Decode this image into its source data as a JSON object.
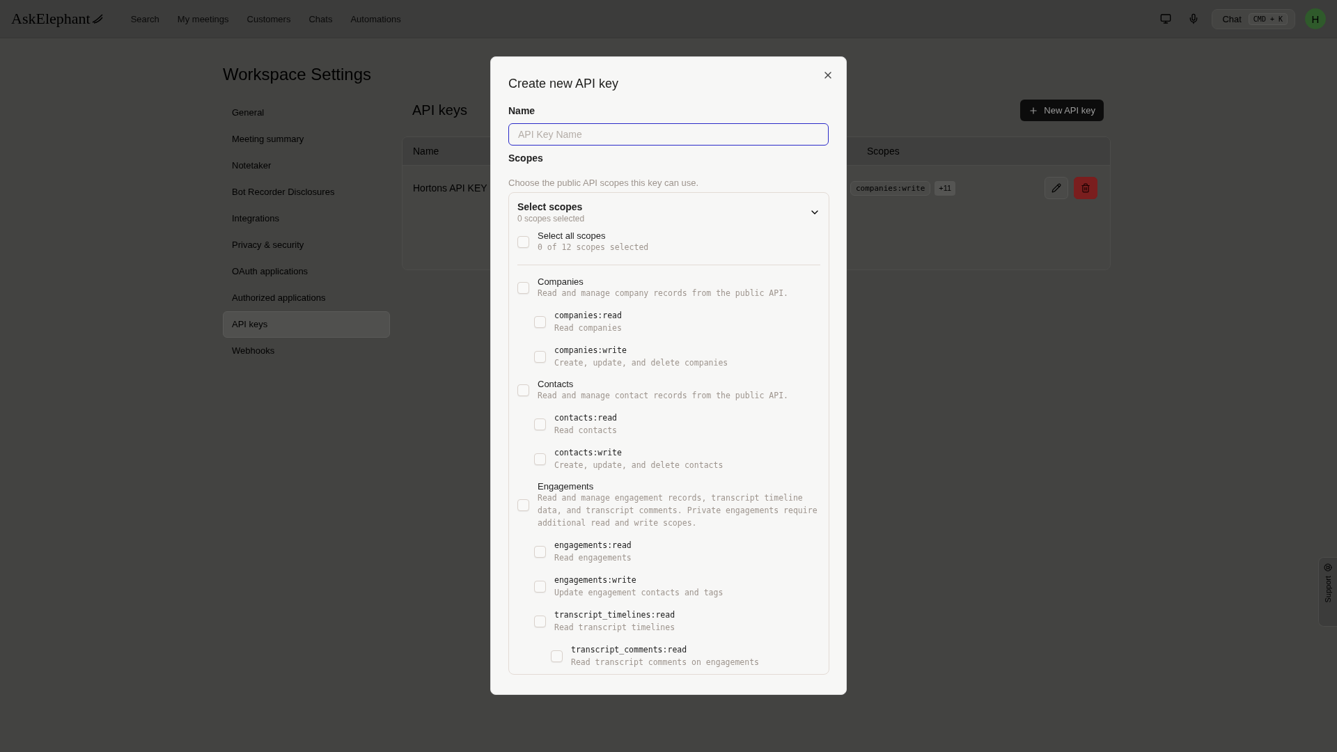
{
  "top_bar": {
    "logo": "AskElephant",
    "nav": [
      "Search",
      "My meetings",
      "Customers",
      "Chats",
      "Automations"
    ],
    "chat_button": "Chat",
    "shortcut": "CMD + K",
    "avatar": "H"
  },
  "page_title": "Workspace Settings",
  "sidebar": {
    "items": [
      {
        "label": "General",
        "selected": false
      },
      {
        "label": "Meeting summary",
        "selected": false
      },
      {
        "label": "Notetaker",
        "selected": false
      },
      {
        "label": "Bot Recorder Disclosures",
        "selected": false
      },
      {
        "label": "Integrations",
        "selected": false
      },
      {
        "label": "Privacy & security",
        "selected": false
      },
      {
        "label": "OAuth applications",
        "selected": false
      },
      {
        "label": "Authorized applications",
        "selected": false
      },
      {
        "label": "API keys",
        "selected": true
      },
      {
        "label": "Webhooks",
        "selected": false
      }
    ]
  },
  "content": {
    "title": "API keys",
    "new_button": "New API key",
    "table": {
      "columns": [
        "Name",
        "Scopes"
      ],
      "rows": [
        {
          "name": "Hortons API KEY",
          "scopes": [
            "companies:write"
          ],
          "more": "+11"
        }
      ]
    }
  },
  "support_tab": "Support",
  "dialog": {
    "title": "Create new API key",
    "name_label": "Name",
    "name_placeholder": "API Key Name",
    "scopes_label": "Scopes",
    "scopes_hint": "Choose the public API scopes this key can use.",
    "selector": {
      "title": "Select scopes",
      "summary": "0 scopes selected",
      "expanded": true,
      "select_all": {
        "label": "Select all scopes",
        "summary": "0 of 12 scopes selected",
        "checked": false
      },
      "groups": [
        {
          "name": "Companies",
          "description": "Read and manage company records from the public API.",
          "checked": false,
          "children": [
            {
              "name": "companies:read",
              "description": "Read companies",
              "checked": false
            },
            {
              "name": "companies:write",
              "description": "Create, update, and delete companies",
              "checked": false
            }
          ]
        },
        {
          "name": "Contacts",
          "description": "Read and manage contact records from the public API.",
          "checked": false,
          "children": [
            {
              "name": "contacts:read",
              "description": "Read contacts",
              "checked": false
            },
            {
              "name": "contacts:write",
              "description": "Create, update, and delete contacts",
              "checked": false
            }
          ]
        },
        {
          "name": "Engagements",
          "description": "Read and manage engagement records, transcript timeline data, and transcript comments. Private engagements require additional read and write scopes.",
          "checked": false,
          "children": [
            {
              "name": "engagements:read",
              "description": "Read engagements",
              "checked": false
            },
            {
              "name": "engagements:write",
              "description": "Update engagement contacts and tags",
              "checked": false
            },
            {
              "name": "transcript_timelines:read",
              "description": "Read transcript timelines",
              "checked": false,
              "children": [
                {
                  "name": "transcript_comments:read",
                  "description": "Read transcript comments on engagements",
                  "checked": false
                }
              ]
            }
          ]
        }
      ]
    }
  }
}
